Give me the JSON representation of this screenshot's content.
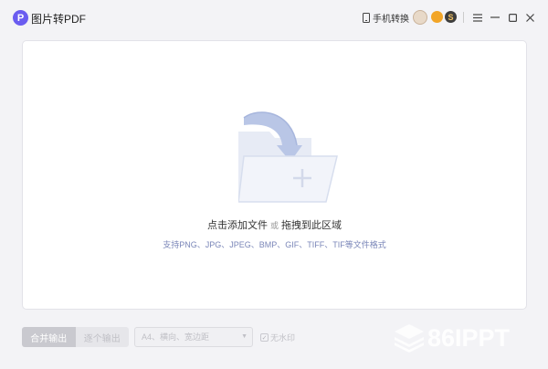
{
  "app": {
    "logo_letter": "P",
    "title": "图片转PDF"
  },
  "header": {
    "phone_switch_label": "手机转换",
    "badge_dark_letter": "S",
    "window_controls": [
      "menu-icon",
      "minimize-icon",
      "maximize-icon",
      "close-icon"
    ]
  },
  "drop_zone": {
    "primary_text": "点击添加文件",
    "or_text": "或",
    "secondary_text": "拖拽到此区域",
    "formats_text": "支持PNG、JPG、JPEG、BMP、GIF、TIFF、TIF等文件格式"
  },
  "bottom_bar": {
    "merge_output_label": "合并输出",
    "single_output_label": "逐个输出",
    "page_setting_value": "A4、横向、宽边距",
    "no_watermark_label": "无水印"
  },
  "watermark": {
    "brand_text": "86IPPT"
  },
  "colors": {
    "logo": "#6a5cf0",
    "folder_blue": "#c4cfe9",
    "formats_text": "#7a86b8"
  }
}
